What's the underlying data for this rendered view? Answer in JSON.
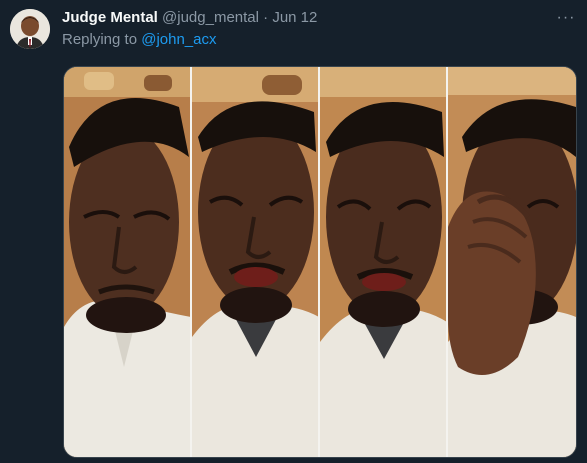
{
  "tweet": {
    "author_name": "Judge Mental",
    "author_handle": "@judg_mental",
    "separator": "·",
    "date": "Jun 12",
    "more_icon": "more-horizontal-icon",
    "reply_prefix": "Replying to",
    "reply_handle": "@john_acx"
  },
  "media": {
    "panel_count": 4,
    "background_color": "#c58a54",
    "shirt_color": "#e9e6dc"
  },
  "colors": {
    "background": "#15202b",
    "text_primary": "#f7f9f9",
    "text_secondary": "#8b98a5",
    "link": "#1d9bf0",
    "border": "#38444d"
  }
}
